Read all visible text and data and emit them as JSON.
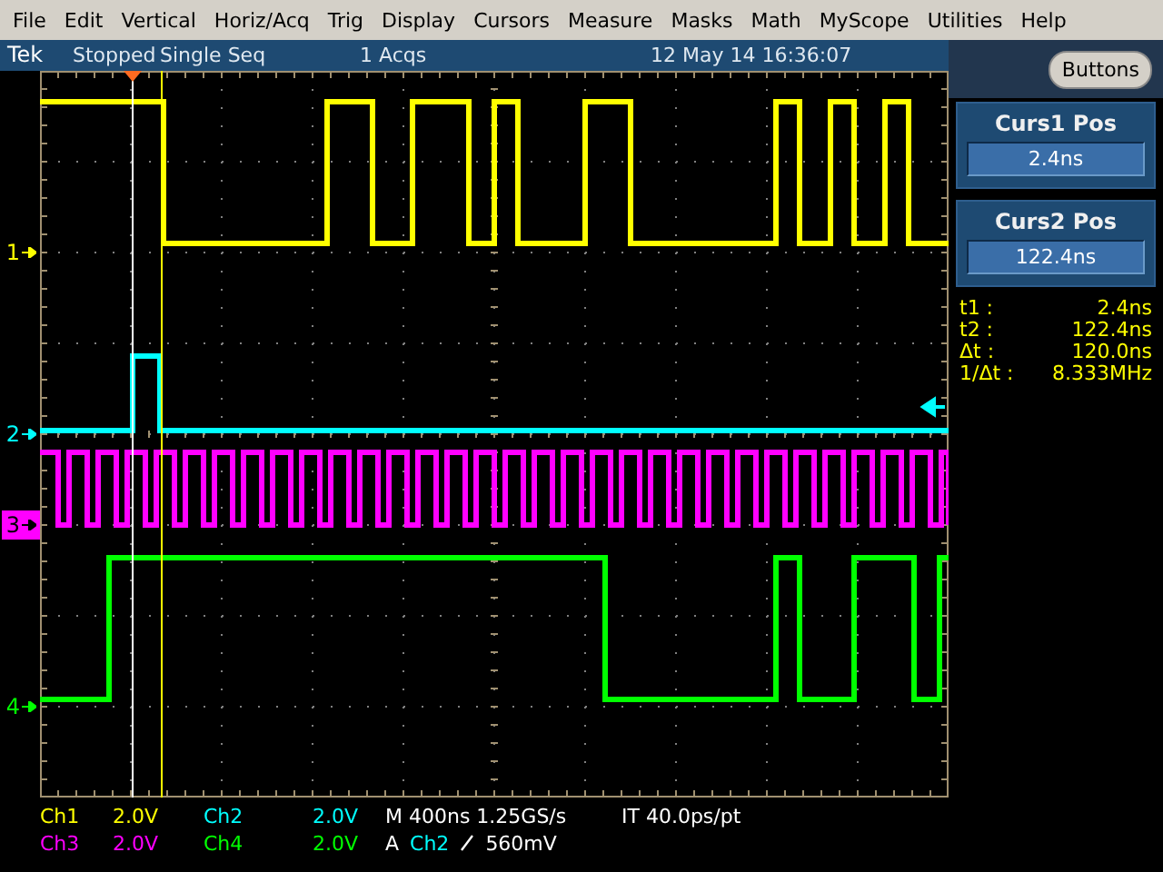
{
  "menu": [
    "File",
    "Edit",
    "Vertical",
    "Horiz/Acq",
    "Trig",
    "Display",
    "Cursors",
    "Measure",
    "Masks",
    "Math",
    "MyScope",
    "Utilities",
    "Help"
  ],
  "status_bar": {
    "brand": "Tek",
    "state": "Stopped",
    "mode": "Single Seq",
    "acquisitions": "1 Acqs",
    "datetime": "12 May 14 16:36:07"
  },
  "buttons_button": "Buttons",
  "cursor_panels": [
    {
      "title": "Curs1 Pos",
      "value": "2.4ns"
    },
    {
      "title": "Curs2 Pos",
      "value": "122.4ns"
    }
  ],
  "cursor_readouts": [
    {
      "label": "t1 :",
      "value": "2.4ns"
    },
    {
      "label": "t2 :",
      "value": "122.4ns"
    },
    {
      "label": "Δt :",
      "value": "120.0ns"
    },
    {
      "label": "1/Δt :",
      "value": "8.333MHz"
    }
  ],
  "channels": [
    {
      "marker": "1",
      "color": "#ffff00",
      "selected": false
    },
    {
      "marker": "2",
      "color": "#00ffff",
      "selected": false
    },
    {
      "marker": "3",
      "color": "#ff00ff",
      "selected": true
    },
    {
      "marker": "4",
      "color": "#00ff00",
      "selected": false
    }
  ],
  "scale_readouts": [
    {
      "channel": "Ch1",
      "scale": "2.0V",
      "color": "#ffff00"
    },
    {
      "channel": "Ch2",
      "scale": "2.0V",
      "color": "#00ffff"
    },
    {
      "channel": "Ch3",
      "scale": "2.0V",
      "color": "#ff00ff"
    },
    {
      "channel": "Ch4",
      "scale": "2.0V",
      "color": "#00ff00"
    }
  ],
  "timebase": {
    "horizontal": "M 400ns 1.25GS/s",
    "interval": "IT 40.0ps/pt",
    "trigger_label": "A",
    "trigger_source": "Ch2",
    "trigger_level": "560mV"
  }
}
